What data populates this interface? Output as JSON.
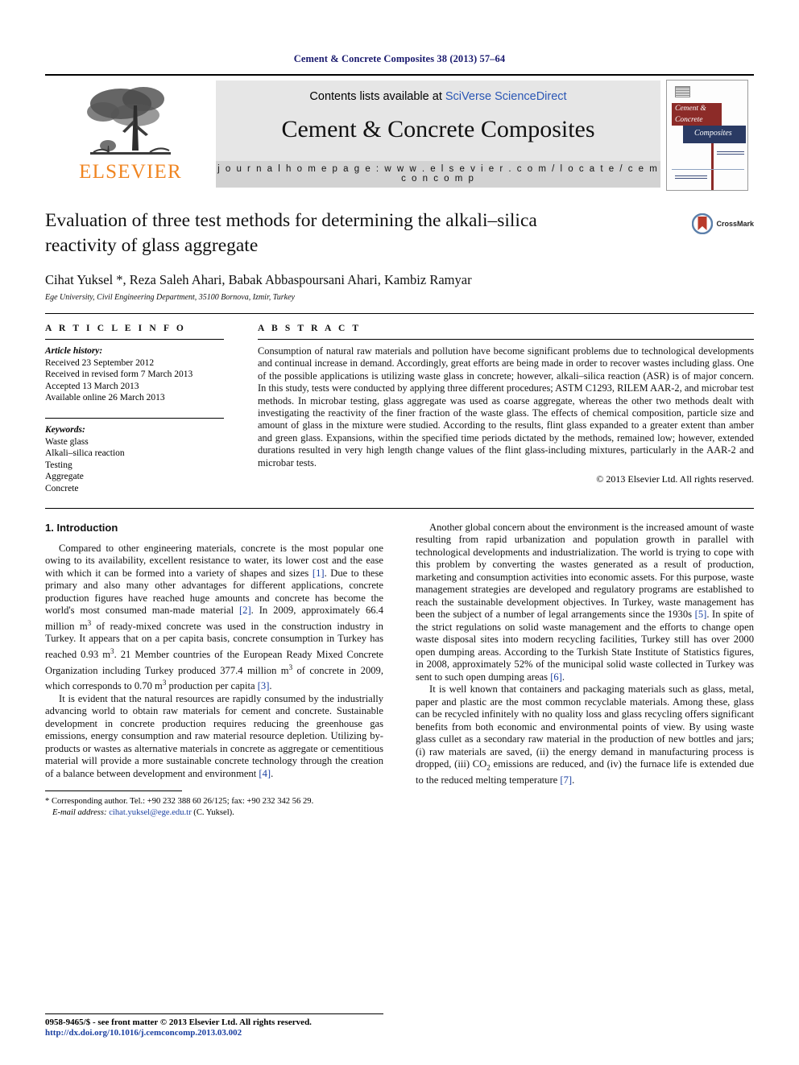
{
  "running_head": "Cement & Concrete Composites 38 (2013) 57–64",
  "masthead": {
    "contents_prefix": "Contents lists available at ",
    "contents_link": "SciVerse ScienceDirect",
    "journal_name": "Cement & Concrete Composites",
    "homepage": "j o u r n a l   h o m e p a g e :   w w w . e l s e v i e r . c o m / l o c a t e / c e m c o n c o m p",
    "publisher": "ELSEVIER",
    "cover": {
      "line1": "Cement &",
      "line2": "Concrete",
      "line3": "Composites"
    }
  },
  "article": {
    "title": "Evaluation of three test methods for determining the alkali–silica reactivity of glass aggregate",
    "authors": "Cihat Yuksel *, Reza Saleh Ahari, Babak Abbaspoursani Ahari, Kambiz Ramyar",
    "affiliation": "Ege University, Civil Engineering Department, 35100 Bornova, Izmir, Turkey",
    "crossmark_label": "CrossMark"
  },
  "info": {
    "heading": "A R T I C L E   I N F O",
    "history_label": "Article history:",
    "history": [
      "Received 23 September 2012",
      "Received in revised form 7 March 2013",
      "Accepted 13 March 2013",
      "Available online 26 March 2013"
    ],
    "keywords_label": "Keywords:",
    "keywords": [
      "Waste glass",
      "Alkali–silica reaction",
      "Testing",
      "Aggregate",
      "Concrete"
    ]
  },
  "abstract": {
    "heading": "A B S T R A C T",
    "text": "Consumption of natural raw materials and pollution have become significant problems due to technological developments and continual increase in demand. Accordingly, great efforts are being made in order to recover wastes including glass. One of the possible applications is utilizing waste glass in concrete; however, alkali–silica reaction (ASR) is of major concern. In this study, tests were conducted by applying three different procedures; ASTM C1293, RILEM AAR-2, and microbar test methods. In microbar testing, glass aggregate was used as coarse aggregate, whereas the other two methods dealt with investigating the reactivity of the finer fraction of the waste glass. The effects of chemical composition, particle size and amount of glass in the mixture were studied. According to the results, flint glass expanded to a greater extent than amber and green glass. Expansions, within the specified time periods dictated by the methods, remained low; however, extended durations resulted in very high length change values of the flint glass-including mixtures, particularly in the AAR-2 and microbar tests.",
    "copyright": "© 2013 Elsevier Ltd. All rights reserved."
  },
  "body": {
    "section_heading": "1. Introduction",
    "left_paragraphs": [
      "Compared to other engineering materials, concrete is the most popular one owing to its availability, excellent resistance to water, its lower cost and the ease with which it can be formed into a variety of shapes and sizes [1]. Due to these primary and also many other advantages for different applications, concrete production figures have reached huge amounts and concrete has become the world's most consumed man-made material [2]. In 2009, approximately 66.4 million m3 of ready-mixed concrete was used in the construction industry in Turkey. It appears that on a per capita basis, concrete consumption in Turkey has reached 0.93 m3. 21 Member countries of the European Ready Mixed Concrete Organization including Turkey produced 377.4 million m3 of concrete in 2009, which corresponds to 0.70 m3 production per capita [3].",
      "It is evident that the natural resources are rapidly consumed by the industrially advancing world to obtain raw materials for cement and concrete. Sustainable development in concrete production requires reducing the greenhouse gas emissions, energy consumption and raw material resource depletion. Utilizing by-products or wastes as alternative materials in concrete as aggregate or cementitious material will provide a more sustainable concrete technology through the creation of a balance between development and environment [4]."
    ],
    "right_paragraphs": [
      "Another global concern about the environment is the increased amount of waste resulting from rapid urbanization and population growth in parallel with technological developments and industrialization. The world is trying to cope with this problem by converting the wastes generated as a result of production, marketing and consumption activities into economic assets. For this purpose, waste management strategies are developed and regulatory programs are established to reach the sustainable development objectives. In Turkey, waste management has been the subject of a number of legal arrangements since the 1930s [5]. In spite of the strict regulations on solid waste management and the efforts to change open waste disposal sites into modern recycling facilities, Turkey still has over 2000 open dumping areas. According to the Turkish State Institute of Statistics figures, in 2008, approximately 52% of the municipal solid waste collected in Turkey was sent to such open dumping areas [6].",
      "It is well known that containers and packaging materials such as glass, metal, paper and plastic are the most common recyclable materials. Among these, glass can be recycled infinitely with no quality loss and glass recycling offers significant benefits from both economic and environmental points of view. By using waste glass cullet as a secondary raw material in the production of new bottles and jars; (i) raw materials are saved, (ii) the energy demand in manufacturing process is dropped, (iii) CO2 emissions are reduced, and (iv) the furnace life is extended due to the reduced melting temperature [7]."
    ]
  },
  "footnotes": {
    "corresponding": "* Corresponding author. Tel.: +90 232 388 60 26/125; fax: +90 232 342 56 29.",
    "email_label": "E-mail address:",
    "email": "cihat.yuksel@ege.edu.tr",
    "email_suffix": " (C. Yuksel).",
    "issn_line": "0958-9465/$ - see front matter © 2013 Elsevier Ltd. All rights reserved.",
    "doi": "http://dx.doi.org/10.1016/j.cemconcomp.2013.03.002"
  },
  "colors": {
    "link": "#1a3fa0",
    "elsevier_orange": "#F08521",
    "runhead_navy": "#1a1a6e",
    "cover_red": "#8c2b28",
    "cover_navy": "#2a3a63"
  }
}
